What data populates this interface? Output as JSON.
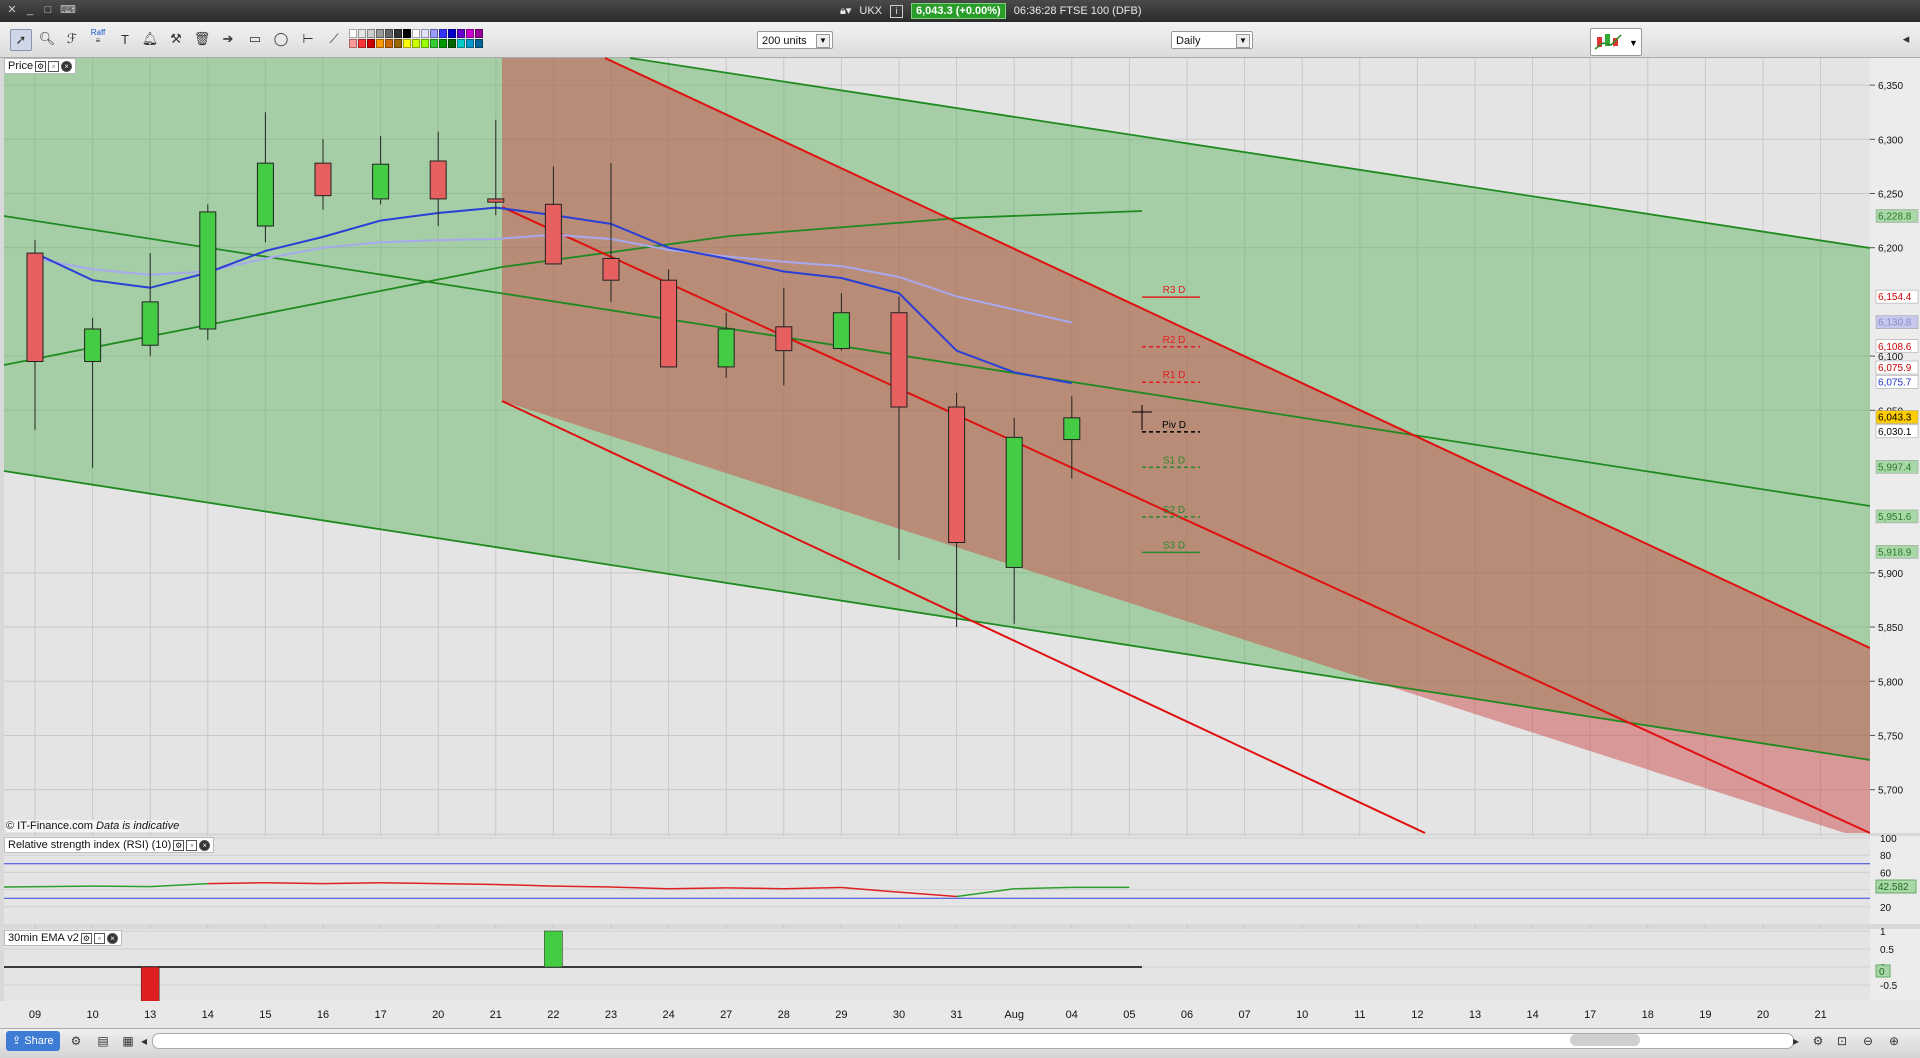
{
  "window": {
    "instrument": "UKX",
    "price_badge": "6,043.3 (+0.00%)",
    "time_and_name": "06:36:28 FTSE 100 (DFB)",
    "info_icon": "info-icon",
    "lock_icon": "lock-icon"
  },
  "toolbar": {
    "units_select": "200 units",
    "interval_select": "Daily",
    "tools": [
      "pointer-icon",
      "zoom-icon",
      "fib-icon",
      "trendline-icon",
      "text-icon",
      "alert-icon",
      "measure-icon",
      "delete-icon",
      "arrow-icon",
      "rectangle-icon",
      "ellipse-icon",
      "horizontal-line-icon",
      "pencil-icon"
    ],
    "raff_label": "Raff",
    "swatch_colors": [
      "#ffffff",
      "#e6e6e6",
      "#cccccc",
      "#999999",
      "#666666",
      "#333333",
      "#000000",
      "#ffffff",
      "#e0e0ff",
      "#9999ff",
      "#3333ff",
      "#0000cc",
      "#6600cc",
      "#cc00cc",
      "#990099",
      "#ff9999",
      "#ff3333",
      "#cc0000",
      "#ff9900",
      "#cc6600",
      "#996600",
      "#ffff00",
      "#ccff00",
      "#99ff00",
      "#33cc33",
      "#009900",
      "#006600",
      "#00cccc",
      "#0099cc",
      "#006699"
    ]
  },
  "price_panel": {
    "label": "Price",
    "copyright": "© IT-Finance.com",
    "note": "Data is indicative",
    "y_ticks": [
      "6,350",
      "6,300",
      "6,250",
      "6,200",
      "6,100",
      "6,050",
      "5,900",
      "5,850",
      "5,800",
      "5,750",
      "5,700"
    ],
    "price_tags": [
      {
        "text": "6,228.8",
        "value": 6228.8,
        "bg": "#a8d8a8",
        "fg": "#2a7a2a"
      },
      {
        "text": "6,154.4",
        "value": 6154.4,
        "bg": "#ffffff",
        "fg": "#cc0000"
      },
      {
        "text": "6,130.8",
        "value": 6130.8,
        "bg": "#c8c8ee",
        "fg": "#8888cc"
      },
      {
        "text": "6,108.6",
        "value": 6108.6,
        "bg": "#ffffff",
        "fg": "#cc0000"
      },
      {
        "text": "6,075.9",
        "value": 6089.0,
        "bg": "#ffffff",
        "fg": "#cc0000"
      },
      {
        "text": "6,075.7",
        "value": 6075.7,
        "bg": "#ffffff",
        "fg": "#2233cc"
      },
      {
        "text": "6,043.3",
        "value": 6043.3,
        "bg": "#ffcc00",
        "fg": "#000000"
      },
      {
        "text": "6,030.1",
        "value": 6030.1,
        "bg": "#ffffff",
        "fg": "#000000"
      },
      {
        "text": "5,997.4",
        "value": 5997.4,
        "bg": "#a8d8a8",
        "fg": "#2a7a2a"
      },
      {
        "text": "5,951.6",
        "value": 5951.6,
        "bg": "#a8d8a8",
        "fg": "#2a7a2a"
      },
      {
        "text": "5,918.9",
        "value": 5918.9,
        "bg": "#a8d8a8",
        "fg": "#2a7a2a"
      }
    ],
    "pivots": [
      {
        "label": "R3 D",
        "value": 6154.4,
        "color": "#e02020",
        "dashed": false
      },
      {
        "label": "R2 D",
        "value": 6108.6,
        "color": "#e02020",
        "dashed": true
      },
      {
        "label": "R1 D",
        "value": 6075.9,
        "color": "#e02020",
        "dashed": true
      },
      {
        "label": "Piv D",
        "value": 6030.1,
        "color": "#000000",
        "dashed": true
      },
      {
        "label": "S1 D",
        "value": 5997.4,
        "color": "#2a8a2a",
        "dashed": true
      },
      {
        "label": "S2 D",
        "value": 5951.6,
        "color": "#2a8a2a",
        "dashed": true
      },
      {
        "label": "S3 D",
        "value": 5918.9,
        "color": "#2a8a2a",
        "dashed": false
      }
    ]
  },
  "rsi_panel": {
    "label": "Relative strength index (RSI) (10)",
    "y_ticks": [
      "100",
      "80",
      "60",
      "40",
      "20"
    ],
    "value_tag": "42.582"
  },
  "ema_panel": {
    "label": "30min EMA v2",
    "y_ticks": [
      "1",
      "0.5",
      "0",
      "-0.5"
    ],
    "value_tag": "0"
  },
  "x_axis": [
    "09",
    "10",
    "13",
    "14",
    "15",
    "16",
    "17",
    "20",
    "21",
    "22",
    "23",
    "24",
    "27",
    "28",
    "29",
    "30",
    "31",
    "Aug",
    "04",
    "05",
    "06",
    "07",
    "10",
    "11",
    "12",
    "13",
    "14",
    "17",
    "18",
    "19",
    "20",
    "21"
  ],
  "bottombar": {
    "share": "Share"
  },
  "chart_data": {
    "type": "candlestick",
    "ylim": [
      5660,
      6375
    ],
    "categories": [
      "09",
      "10",
      "13",
      "14",
      "15",
      "16",
      "17",
      "20",
      "21",
      "22",
      "23",
      "24",
      "27",
      "28",
      "29",
      "30",
      "31",
      "Aug",
      "04"
    ],
    "ohlc": [
      {
        "o": 6195,
        "h": 6207,
        "l": 6032,
        "c": 6095
      },
      {
        "o": 6095,
        "h": 6135,
        "l": 5997,
        "c": 6125
      },
      {
        "o": 6110,
        "h": 6195,
        "l": 6100,
        "c": 6150
      },
      {
        "o": 6125,
        "h": 6240,
        "l": 6115,
        "c": 6233
      },
      {
        "o": 6220,
        "h": 6325,
        "l": 6205,
        "c": 6278
      },
      {
        "o": 6278,
        "h": 6300,
        "l": 6235,
        "c": 6248
      },
      {
        "o": 6245,
        "h": 6303,
        "l": 6240,
        "c": 6277
      },
      {
        "o": 6280,
        "h": 6307,
        "l": 6220,
        "c": 6245
      },
      {
        "o": 6245,
        "h": 6318,
        "l": 6230,
        "c": 6242
      },
      {
        "o": 6240,
        "h": 6275,
        "l": 6193,
        "c": 6185
      },
      {
        "o": 6190,
        "h": 6278,
        "l": 6150,
        "c": 6170
      },
      {
        "o": 6170,
        "h": 6180,
        "l": 6093,
        "c": 6090
      },
      {
        "o": 6090,
        "h": 6140,
        "l": 6080,
        "c": 6125
      },
      {
        "o": 6127,
        "h": 6163,
        "l": 6073,
        "c": 6105
      },
      {
        "o": 6107,
        "h": 6158,
        "l": 6105,
        "c": 6140
      },
      {
        "o": 6140,
        "h": 6155,
        "l": 5912,
        "c": 6053
      },
      {
        "o": 6053,
        "h": 6066,
        "l": 5850,
        "c": 5928
      },
      {
        "o": 5905,
        "h": 6043,
        "l": 5853,
        "c": 6025
      },
      {
        "o": 6023,
        "h": 6063,
        "l": 5987,
        "c": 6043
      }
    ],
    "blue_line": [
      6195,
      6170,
      6163,
      6177,
      6197,
      6210,
      6225,
      6232,
      6237,
      6230,
      6222,
      6200,
      6190,
      6178,
      6172,
      6158,
      6105,
      6085,
      6075
    ],
    "lavender_line": [
      6190,
      6180,
      6175,
      6178,
      6190,
      6200,
      6205,
      6207,
      6208,
      6212,
      6208,
      6198,
      6192,
      6187,
      6183,
      6173,
      6155,
      6143,
      6131
    ],
    "rsi": [
      {
        "x": 0,
        "v": 43
      },
      {
        "x": 1,
        "v": 44
      },
      {
        "x": 2,
        "v": 43.5
      },
      {
        "x": 3,
        "v": 47
      },
      {
        "x": 4,
        "v": 48
      },
      {
        "x": 5,
        "v": 47
      },
      {
        "x": 6,
        "v": 48
      },
      {
        "x": 7,
        "v": 47
      },
      {
        "x": 8,
        "v": 46
      },
      {
        "x": 9,
        "v": 44
      },
      {
        "x": 10,
        "v": 43
      },
      {
        "x": 11,
        "v": 41
      },
      {
        "x": 12,
        "v": 42
      },
      {
        "x": 13,
        "v": 41
      },
      {
        "x": 14,
        "v": 42.5
      },
      {
        "x": 15,
        "v": 37
      },
      {
        "x": 16,
        "v": 32
      },
      {
        "x": 17,
        "v": 41
      },
      {
        "x": 18,
        "v": 42.6
      },
      {
        "x": 19,
        "v": 42.6
      }
    ],
    "rsi_levels": [
      70,
      30
    ],
    "ema_bars": [
      {
        "x": 2,
        "v": -1
      },
      {
        "x": 9,
        "v": 1
      }
    ]
  }
}
